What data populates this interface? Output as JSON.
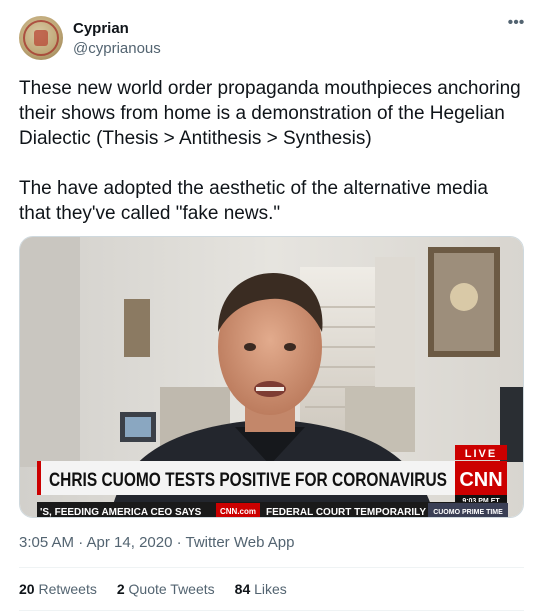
{
  "author": {
    "name": "Cyprian",
    "handle": "@cyprianous"
  },
  "tweet": {
    "text": "These new world order propaganda mouthpieces anchoring their shows from home is a demonstration of the Hegelian Dialectic (Thesis > Antithesis > Synthesis)\n\nThe have adopted the aesthetic of the alternative media that they've called \"fake news.\"",
    "timestamp": "3:05 AM · Apr 14, 2020 · Twitter Web App"
  },
  "media": {
    "live_label": "LIVE",
    "headline": "CHRIS CUOMO TESTS POSITIVE FOR CORONAVIRUS",
    "network_logo": "CNN",
    "time": "9:03 PM ET",
    "ticker_left": "'S, FEEDING AMERICA CEO SAYS",
    "ticker_site": "CNN.com",
    "ticker_right": "FEDERAL COURT TEMPORARILY",
    "program": "CUOMO PRIME TIME"
  },
  "stats": {
    "retweets_count": "20",
    "retweets_label": "Retweets",
    "quotes_count": "2",
    "quotes_label": "Quote Tweets",
    "likes_count": "84",
    "likes_label": "Likes"
  },
  "colors": {
    "cnn_red": "#cc0000",
    "text_primary": "#0f1419",
    "text_secondary": "#536471"
  },
  "icons": {
    "more": "ellipsis-icon"
  }
}
